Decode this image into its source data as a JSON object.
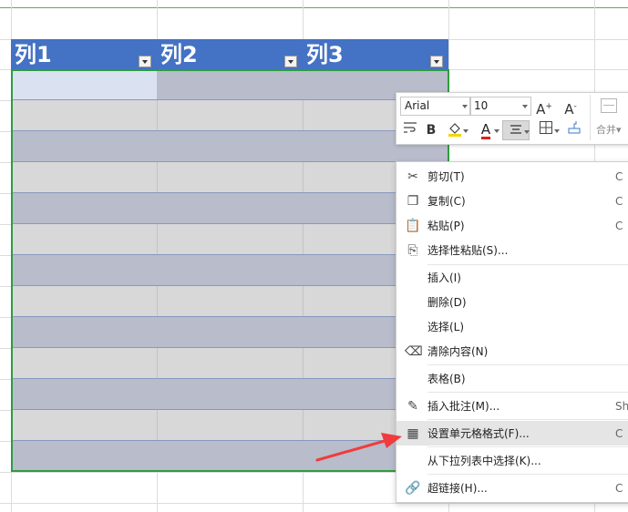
{
  "table": {
    "headers": [
      "列1",
      "列2",
      "列3"
    ],
    "colors": {
      "header": "#4472c4",
      "band_dark": "#b8bccb",
      "band_light": "#d8d8d8",
      "active_cell": "#dae1f1",
      "selection": "#2e9c3e"
    }
  },
  "mini_toolbar": {
    "font_name": "Arial",
    "font_size": "10",
    "grow_font": "A",
    "grow_font_sup": "+",
    "shrink_font": "A",
    "shrink_font_sup": "-",
    "bold": "B",
    "font_color_label": "A",
    "merge_label": "合并",
    "icons": [
      "wrap-icon",
      "bold-icon",
      "fill-color-icon",
      "font-color-icon",
      "align-center-icon",
      "border-icon",
      "format-painter-icon",
      "merge-icon"
    ]
  },
  "context_menu": {
    "items": [
      {
        "label": "剪切(T)",
        "shortcut": "C",
        "icon": "scissors-icon"
      },
      {
        "label": "复制(C)",
        "shortcut": "C",
        "icon": "copy-icon"
      },
      {
        "label": "粘贴(P)",
        "shortcut": "C",
        "icon": "paste-icon"
      },
      {
        "label": "选择性粘贴(S)...",
        "shortcut": "",
        "icon": "paste-special-icon"
      },
      {
        "label": "插入(I)",
        "shortcut": "",
        "icon": ""
      },
      {
        "label": "删除(D)",
        "shortcut": "",
        "icon": ""
      },
      {
        "label": "选择(L)",
        "shortcut": "",
        "icon": ""
      },
      {
        "label": "清除内容(N)",
        "shortcut": "",
        "icon": "eraser-icon"
      },
      {
        "label": "表格(B)",
        "shortcut": "",
        "icon": ""
      },
      {
        "label": "插入批注(M)...",
        "shortcut": "Sh",
        "icon": "comment-icon"
      },
      {
        "label": "设置单元格格式(F)...",
        "shortcut": "C",
        "icon": "format-cells-icon",
        "highlighted": true
      },
      {
        "label": "从下拉列表中选择(K)...",
        "shortcut": "",
        "icon": ""
      },
      {
        "label": "超链接(H)...",
        "shortcut": "C",
        "icon": "link-icon"
      }
    ]
  },
  "annotation": {
    "arrow_color": "#f03c3c"
  }
}
